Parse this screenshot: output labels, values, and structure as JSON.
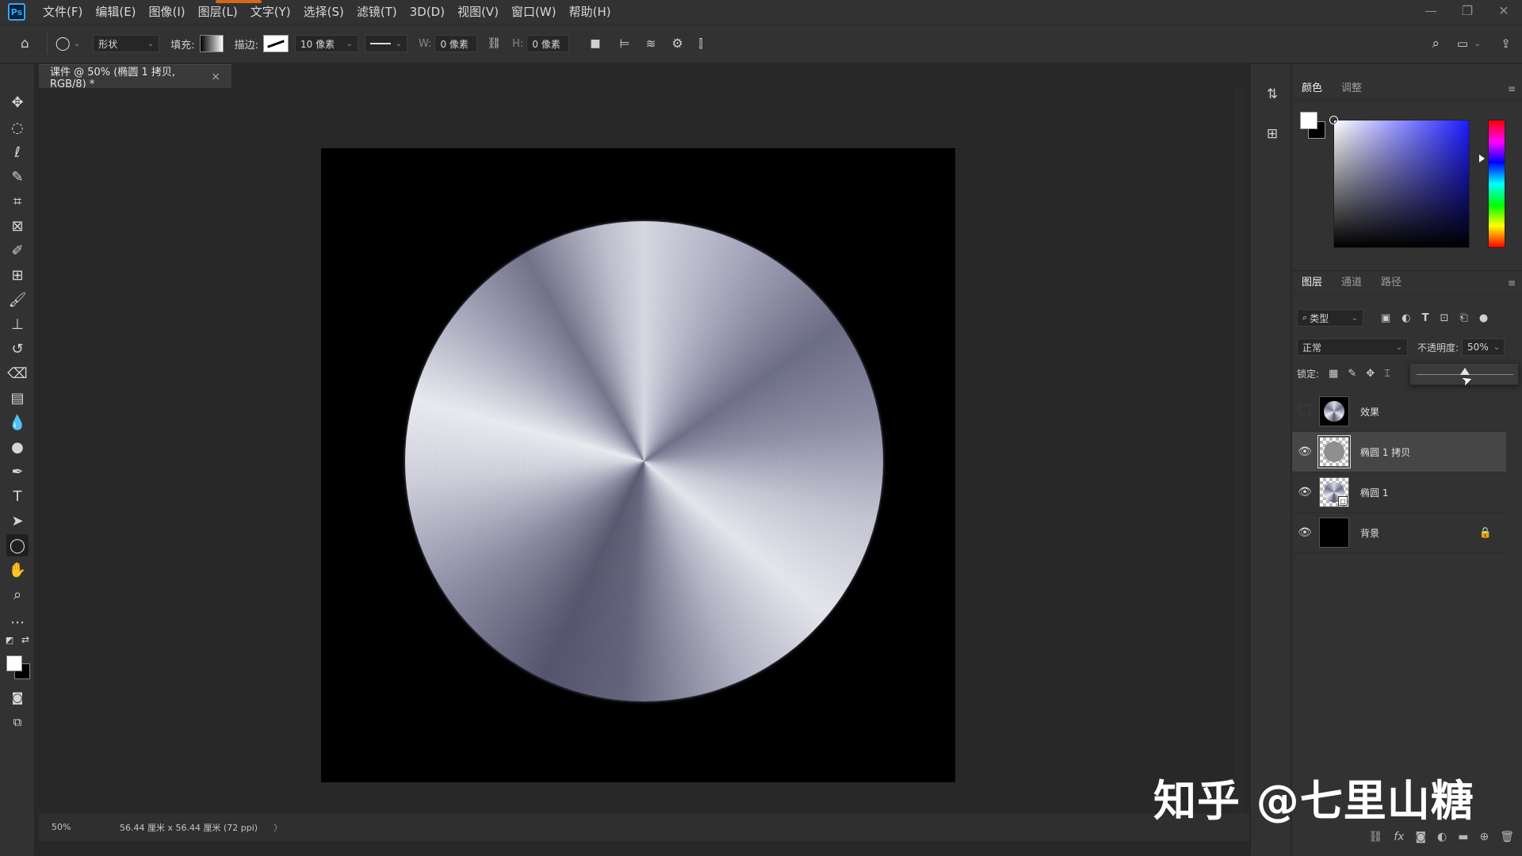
{
  "app": {
    "logo_text": "Ps"
  },
  "menu": [
    "文件(F)",
    "编辑(E)",
    "图像(I)",
    "图层(L)",
    "文字(Y)",
    "选择(S)",
    "滤镜(T)",
    "3D(D)",
    "视图(V)",
    "窗口(W)",
    "帮助(H)"
  ],
  "window_controls": {
    "minimize": "—",
    "restore": "❐",
    "close": "✕"
  },
  "options": {
    "shape_mode": "形状",
    "fill_label": "填充:",
    "stroke_label": "描边:",
    "stroke_width": "10 像素",
    "w_label": "W:",
    "w_value": "0 像素",
    "h_label": "H:",
    "h_value": "0 像素"
  },
  "document": {
    "tab_title": "课件 @ 50% (椭圆 1 拷贝, RGB/8) *",
    "close_glyph": "×"
  },
  "status": {
    "zoom": "50%",
    "info": "56.44 厘米 x 56.44 厘米 (72 ppi)",
    "arrow": "〉"
  },
  "color_panel": {
    "tabs": [
      "颜色",
      "调整"
    ],
    "foreground": "#ffffff",
    "background": "#000000",
    "hue_color": "#1c1cff"
  },
  "layers_panel": {
    "tabs": [
      "图层",
      "通道",
      "路径"
    ],
    "kind_filter": "类型",
    "blend_mode": "正常",
    "opacity_label": "不透明度:",
    "opacity_value": "50%",
    "opacity_fraction": 0.5,
    "lock_label": "锁定:",
    "layers": [
      {
        "name": "效果",
        "visible": false,
        "selected": false,
        "thumb": "disc",
        "locked": false
      },
      {
        "name": "椭圆 1 拷贝",
        "visible": true,
        "selected": true,
        "thumb": "gray-shape",
        "locked": false
      },
      {
        "name": "椭圆 1",
        "visible": true,
        "selected": false,
        "thumb": "disc-shape",
        "locked": false
      },
      {
        "name": "背景",
        "visible": true,
        "selected": false,
        "thumb": "black",
        "locked": true
      }
    ]
  },
  "watermark": "知乎 @七里山糖"
}
